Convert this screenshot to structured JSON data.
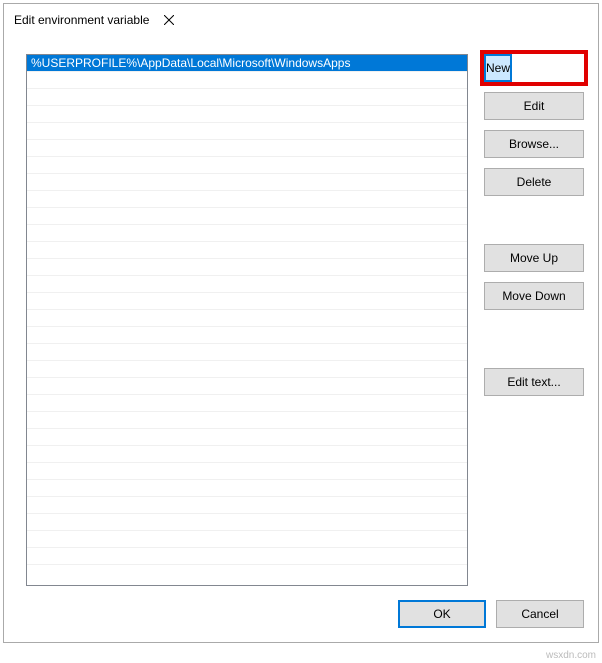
{
  "titlebar": {
    "title": "Edit environment variable"
  },
  "list": {
    "items": [
      {
        "value": "%USERPROFILE%\\AppData\\Local\\Microsoft\\WindowsApps",
        "selected": true
      }
    ],
    "visible_rows": 30
  },
  "buttons": {
    "new": "New",
    "edit": "Edit",
    "browse": "Browse...",
    "delete": "Delete",
    "move_up": "Move Up",
    "move_down": "Move Down",
    "edit_text": "Edit text..."
  },
  "footer": {
    "ok": "OK",
    "cancel": "Cancel"
  },
  "watermark": "wsxdn.com"
}
